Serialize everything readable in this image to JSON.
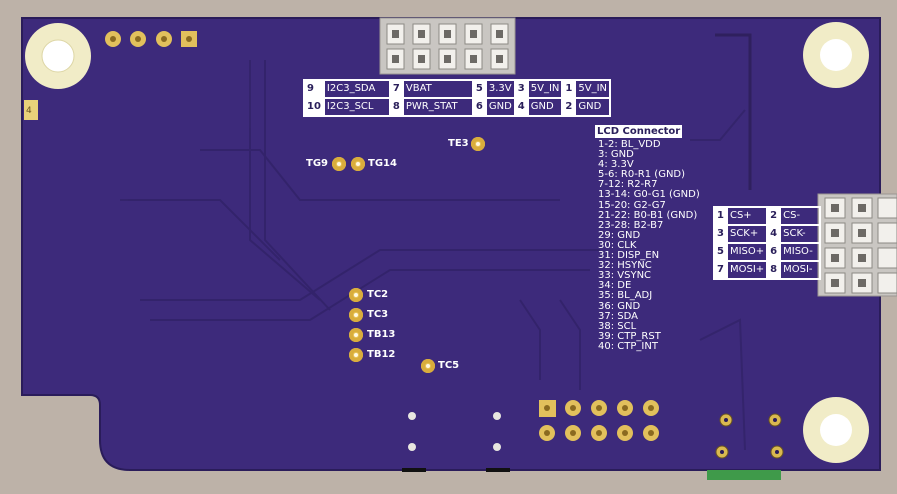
{
  "pin_header": {
    "row1": [
      {
        "num": "9",
        "label": "I2C3_SDA"
      },
      {
        "num": "7",
        "label": "VBAT"
      },
      {
        "num": "5",
        "label": "3.3V"
      },
      {
        "num": "3",
        "label": "5V_IN"
      },
      {
        "num": "1",
        "label": "5V_IN"
      }
    ],
    "row2": [
      {
        "num": "10",
        "label": "I2C3_SCL"
      },
      {
        "num": "8",
        "label": "PWR_STAT"
      },
      {
        "num": "6",
        "label": "GND"
      },
      {
        "num": "4",
        "label": "GND"
      },
      {
        "num": "2",
        "label": "GND"
      }
    ]
  },
  "lcd_connector": {
    "title": "LCD Connector",
    "pins": [
      "1-2: BL_VDD",
      "3: GND",
      "4: 3.3V",
      "5-6: R0-R1 (GND)",
      "7-12: R2-R7",
      "13-14: G0-G1 (GND)",
      "15-20: G2-G7",
      "21-22: B0-B1 (GND)",
      "23-28: B2-B7",
      "29: GND",
      "30: CLK",
      "31: DISP_EN",
      "32: HSYNC",
      "33: VSYNC",
      "34: DE",
      "35: BL_ADJ",
      "36: GND",
      "37: SDA",
      "38: SCL",
      "39: CTP_RST",
      "40: CTP_INT"
    ]
  },
  "spi_header": {
    "row1": [
      {
        "num": "1",
        "label": "CS+"
      },
      {
        "num": "2",
        "label": "CS-"
      }
    ],
    "row2": [
      {
        "num": "3",
        "label": "SCK+"
      },
      {
        "num": "4",
        "label": "SCK-"
      }
    ],
    "row3": [
      {
        "num": "5",
        "label": "MISO+"
      },
      {
        "num": "6",
        "label": "MISO-"
      }
    ],
    "row4": [
      {
        "num": "7",
        "label": "MOSI+"
      },
      {
        "num": "8",
        "label": "MOSI-"
      }
    ]
  },
  "test_points": {
    "tg9": "TG9",
    "tg14": "TG14",
    "te3": "TE3",
    "tc2": "TC2",
    "tc3": "TC3",
    "tb13": "TB13",
    "tb12": "TB12",
    "tc5": "TC5"
  },
  "corner_mark": "4",
  "colors": {
    "board": "#3e2a7a",
    "silk": "#ffffff",
    "gold": "#e2c05c",
    "background": "#bdb2a8"
  }
}
